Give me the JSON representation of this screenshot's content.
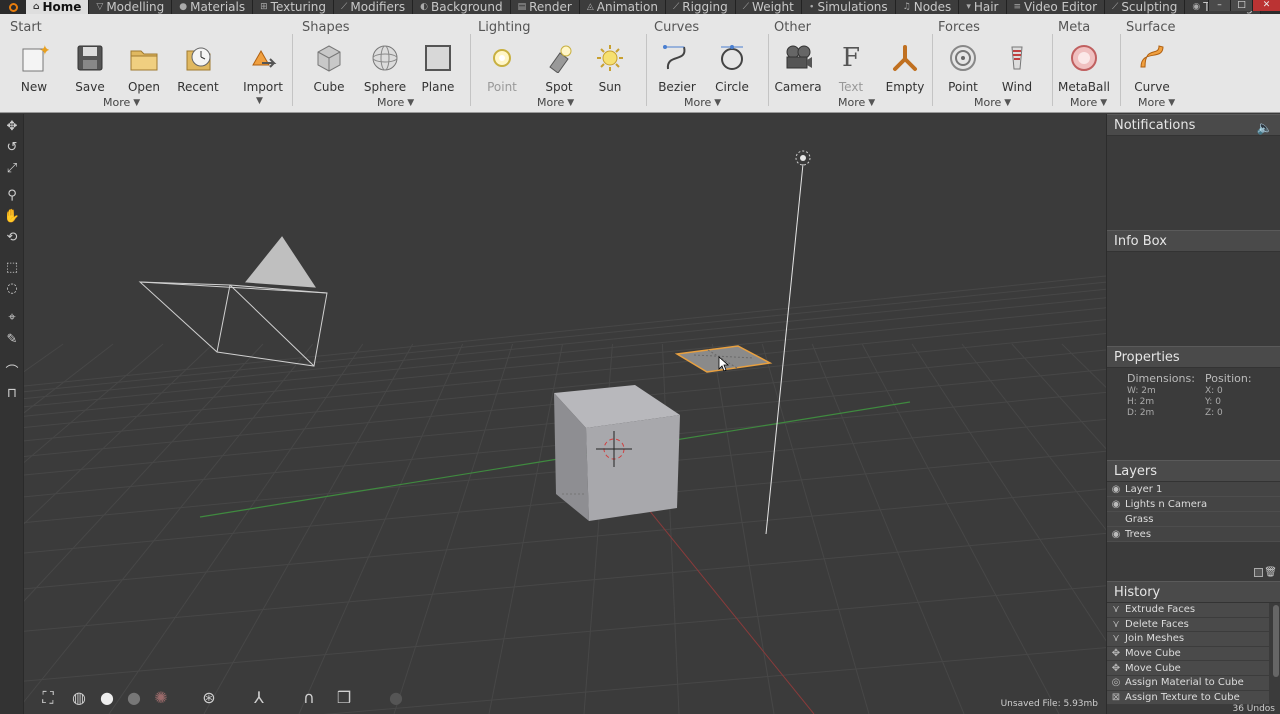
{
  "tabs": [
    {
      "label": "Home",
      "icon": "⌂",
      "active": true
    },
    {
      "label": "Modelling",
      "icon": "▽"
    },
    {
      "label": "Materials",
      "icon": "●"
    },
    {
      "label": "Texturing",
      "icon": "⊞"
    },
    {
      "label": "Modifiers",
      "icon": "⟋"
    },
    {
      "label": "Background",
      "icon": "◐"
    },
    {
      "label": "Render",
      "icon": "▤"
    },
    {
      "label": "Animation",
      "icon": "◬"
    },
    {
      "label": "Rigging",
      "icon": "⟋"
    },
    {
      "label": "Weight",
      "icon": "⟋"
    },
    {
      "label": "Simulations",
      "icon": "∙"
    },
    {
      "label": "Nodes",
      "icon": "♫"
    },
    {
      "label": "Hair",
      "icon": "▾"
    },
    {
      "label": "Video Editor",
      "icon": "≡"
    },
    {
      "label": "Sculpting",
      "icon": "⟋"
    },
    {
      "label": "Tracking",
      "icon": "◉"
    }
  ],
  "window_controls": {
    "minimize": "–",
    "restore": "□",
    "close": "✕"
  },
  "ribbon": {
    "start": {
      "title": "Start",
      "new": "New",
      "save": "Save",
      "open": "Open",
      "recent": "Recent",
      "import": "Import",
      "more": "More"
    },
    "shapes": {
      "title": "Shapes",
      "cube": "Cube",
      "sphere": "Sphere",
      "plane": "Plane",
      "more": "More"
    },
    "lighting": {
      "title": "Lighting",
      "point": "Point",
      "spot": "Spot",
      "sun": "Sun",
      "more": "More"
    },
    "curves": {
      "title": "Curves",
      "bezier": "Bezier",
      "circle": "Circle",
      "more": "More"
    },
    "other": {
      "title": "Other",
      "camera": "Camera",
      "text": "Text",
      "empty": "Empty",
      "more": "More"
    },
    "forces": {
      "title": "Forces",
      "point": "Point",
      "wind": "Wind",
      "more": "More"
    },
    "meta": {
      "title": "Meta",
      "metaball": "MetaBall",
      "more": "More"
    },
    "surface": {
      "title": "Surface",
      "curve": "Curve",
      "more": "More"
    }
  },
  "viewport": {
    "file_status": "Unsaved File: 5.93mb",
    "accent_orange": "#e8a040",
    "grid_color": "#474747",
    "x_axis_color": "#8a3b3b",
    "y_axis_color": "#3f8a3f"
  },
  "panel": {
    "notifications": {
      "title": "Notifications",
      "icon": "speaker-icon"
    },
    "info_box": {
      "title": "Info Box"
    },
    "properties": {
      "title": "Properties",
      "dimensions_label": "Dimensions:",
      "position_label": "Position:",
      "w": "W: 2m",
      "h": "H: 2m",
      "d": "D: 2m",
      "x": "X: 0",
      "y": "Y: 0",
      "z": "Z: 0"
    },
    "layers": {
      "title": "Layers",
      "items": [
        {
          "name": "Layer 1",
          "visible": true
        },
        {
          "name": "Lights n Camera",
          "visible": true
        },
        {
          "name": "Grass",
          "visible": false
        },
        {
          "name": "Trees",
          "visible": true
        }
      ]
    },
    "history": {
      "title": "History",
      "items": [
        "Extrude Faces",
        "Delete Faces",
        "Join Meshes",
        "Move Cube",
        "Move Cube",
        "Assign Material to Cube",
        "Assign Texture to Cube"
      ],
      "undos": "36 Undos"
    }
  }
}
